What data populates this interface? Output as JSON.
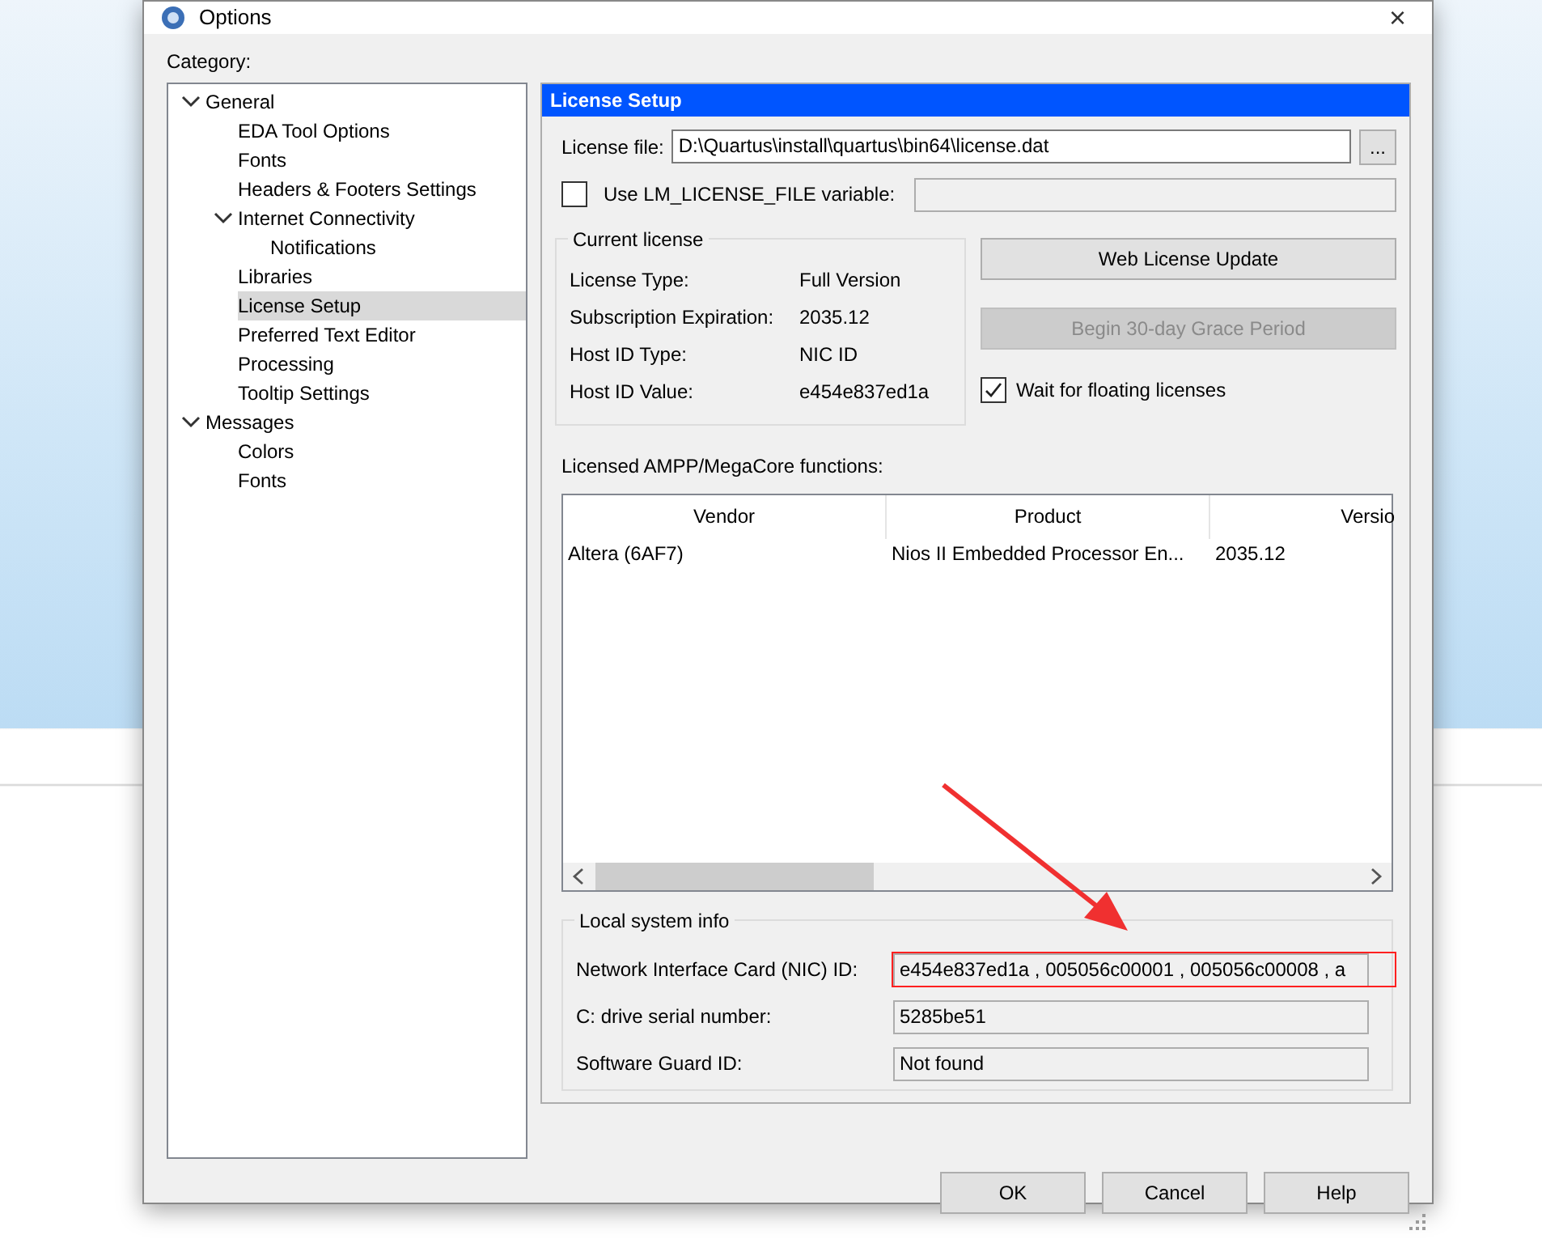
{
  "dialog": {
    "title": "Options",
    "close": "×",
    "category_label": "Category:",
    "tree": [
      {
        "label": "General",
        "expanded": true,
        "selected": false,
        "children": [
          {
            "label": "EDA Tool Options",
            "selected": false
          },
          {
            "label": "Fonts",
            "selected": false
          },
          {
            "label": "Headers & Footers Settings",
            "selected": false
          },
          {
            "label": "Internet Connectivity",
            "expanded": true,
            "selected": false,
            "children": [
              {
                "label": "Notifications",
                "selected": false
              }
            ]
          },
          {
            "label": "Libraries",
            "selected": false
          },
          {
            "label": "License Setup",
            "selected": true
          },
          {
            "label": "Preferred Text Editor",
            "selected": false
          },
          {
            "label": "Processing",
            "selected": false
          },
          {
            "label": "Tooltip Settings",
            "selected": false
          }
        ]
      },
      {
        "label": "Messages",
        "expanded": true,
        "selected": false,
        "children": [
          {
            "label": "Colors",
            "selected": false
          },
          {
            "label": "Fonts",
            "selected": false
          }
        ]
      }
    ],
    "panel": {
      "title": "License Setup",
      "license_file": {
        "label": "License file:",
        "value": "D:\\Quartus\\install\\quartus\\bin64\\license.dat",
        "browse": "..."
      },
      "use_env": {
        "label": "Use LM_LICENSE_FILE variable:",
        "checked": false
      },
      "current_license": {
        "title": "Current license",
        "rows": [
          {
            "label": "License Type:",
            "value": "Full Version"
          },
          {
            "label": "Subscription Expiration:",
            "value": "2035.12"
          },
          {
            "label": "Host ID Type:",
            "value": "NIC ID"
          },
          {
            "label": "Host ID Value:",
            "value": "e454e837ed1a"
          }
        ]
      },
      "buttons": [
        {
          "label": "Web License Update",
          "disabled": false
        },
        {
          "label": "Begin 30-day Grace Period",
          "disabled": true
        }
      ],
      "wait_floating": {
        "label": "Wait for floating licenses",
        "checked": true
      },
      "functions": {
        "label": "Licensed AMPP/MegaCore functions:",
        "columns": [
          "Vendor",
          "Product",
          "Versio"
        ],
        "rows": [
          [
            "Altera (6AF7)",
            "Nios II Embedded Processor En...",
            "2035.12"
          ]
        ]
      },
      "local_info": {
        "title": "Local system info",
        "rows": [
          {
            "label": "Network Interface Card (NIC) ID:",
            "value": "e454e837ed1a , 005056c00001 , 005056c00008 , a",
            "highlighted": true
          },
          {
            "label": "C: drive serial number:",
            "value": "5285be51",
            "highlighted": false
          },
          {
            "label": "Software Guard ID:",
            "value": "Not found",
            "highlighted": false
          }
        ]
      }
    },
    "footer_buttons": [
      "OK",
      "Cancel",
      "Help"
    ]
  }
}
